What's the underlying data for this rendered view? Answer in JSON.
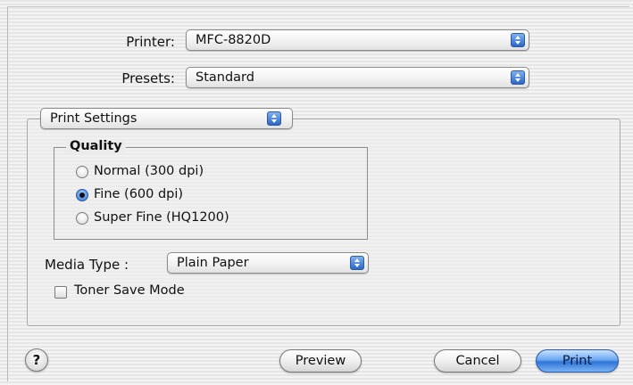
{
  "printer": {
    "label": "Printer:",
    "value": "MFC-8820D"
  },
  "presets": {
    "label": "Presets:",
    "value": "Standard"
  },
  "panel_menu": {
    "value": "Print Settings"
  },
  "quality": {
    "title": "Quality",
    "options": [
      {
        "label": "Normal (300 dpi)",
        "selected": false
      },
      {
        "label": "Fine (600 dpi)",
        "selected": true
      },
      {
        "label": "Super Fine (HQ1200)",
        "selected": false
      }
    ]
  },
  "media_type": {
    "label": "Media Type :",
    "value": "Plain Paper"
  },
  "toner_save": {
    "label": "Toner Save Mode",
    "checked": false
  },
  "buttons": {
    "help": "?",
    "preview": "Preview",
    "cancel": "Cancel",
    "print": "Print"
  }
}
